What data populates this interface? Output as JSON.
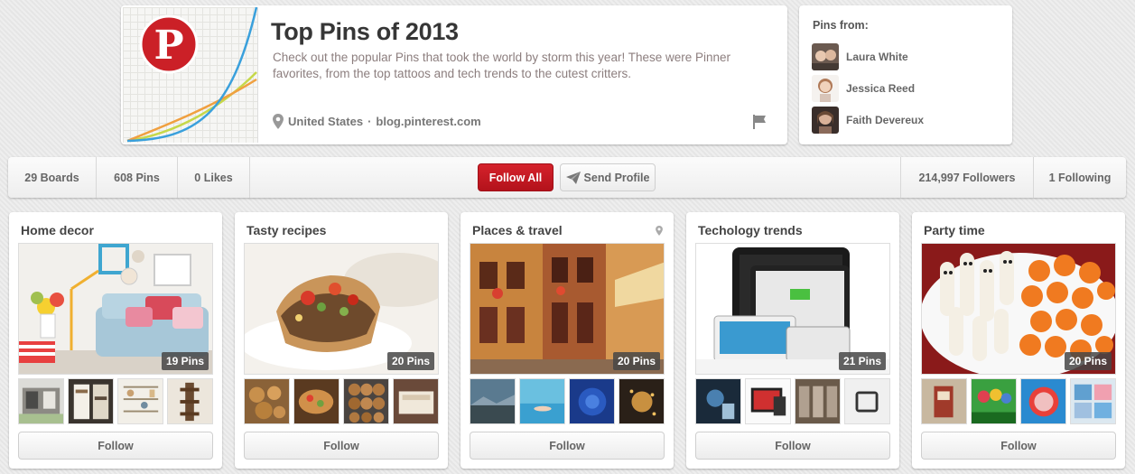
{
  "profile": {
    "title": "Top Pins of 2013",
    "description": "Check out the popular Pins that took the world by storm this year! These were Pinner favorites, from the top tattoos and tech trends to the cutest critters.",
    "location": "United States",
    "website": "blog.pinterest.com",
    "separator": "·",
    "brand_color": "#cb2027"
  },
  "pins_from": {
    "title": "Pins from:",
    "pinners": [
      {
        "name": "Laura White"
      },
      {
        "name": "Jessica Reed"
      },
      {
        "name": "Faith Devereux"
      }
    ]
  },
  "stats": {
    "boards": "29 Boards",
    "pins": "608 Pins",
    "likes": "0 Likes",
    "follow_all": "Follow All",
    "send_profile": "Send Profile",
    "followers": "214,997 Followers",
    "following": "1 Following"
  },
  "boards": [
    {
      "title": "Home decor",
      "pin_count": "19 Pins",
      "follow_label": "Follow",
      "has_place_icon": false
    },
    {
      "title": "Tasty recipes",
      "pin_count": "20 Pins",
      "follow_label": "Follow",
      "has_place_icon": false
    },
    {
      "title": "Places & travel",
      "pin_count": "20 Pins",
      "follow_label": "Follow",
      "has_place_icon": true
    },
    {
      "title": "Techology trends",
      "pin_count": "21 Pins",
      "follow_label": "Follow",
      "has_place_icon": false
    },
    {
      "title": "Party time",
      "pin_count": "20 Pins",
      "follow_label": "Follow",
      "has_place_icon": false
    }
  ]
}
